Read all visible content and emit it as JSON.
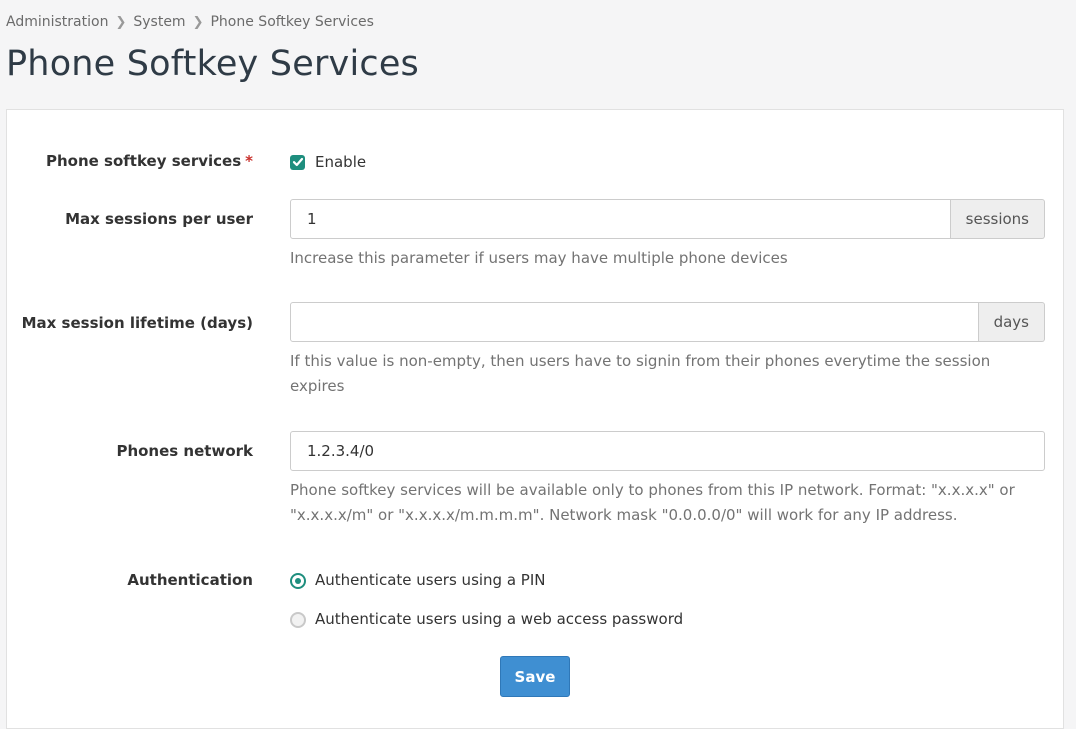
{
  "breadcrumb": {
    "items": [
      "Administration",
      "System",
      "Phone Softkey Services"
    ]
  },
  "page_title": "Phone Softkey Services",
  "form": {
    "softkey": {
      "label": "Phone softkey services",
      "required_mark": "*",
      "checkbox_label": "Enable",
      "checked": true
    },
    "max_sessions": {
      "label": "Max sessions per user",
      "value": "1",
      "addon": "sessions",
      "help": "Increase this parameter if users may have multiple phone devices"
    },
    "max_lifetime": {
      "label": "Max session lifetime (days)",
      "value": "",
      "addon": "days",
      "help_line1": "If this value is non-empty, then users have to signin from their phones everytime the session",
      "help_line2": "expires"
    },
    "phones_network": {
      "label": "Phones network",
      "value": "1.2.3.4/0",
      "help_line1": "Phone softkey services will be available only to phones from this IP network. Format: \"x.x.x.x\" or",
      "help_line2": "\"x.x.x.x/m\" or \"x.x.x.x/m.m.m.m\". Network mask \"0.0.0.0/0\" will work for any IP address."
    },
    "authentication": {
      "label": "Authentication",
      "options": [
        {
          "label": "Authenticate users using a PIN",
          "selected": true
        },
        {
          "label": "Authenticate users using a web access password",
          "selected": false
        }
      ]
    },
    "save_label": "Save"
  },
  "colors": {
    "accent": "#1e8e7e",
    "primary_button": "#3f8fd2",
    "required": "#c9302c"
  }
}
